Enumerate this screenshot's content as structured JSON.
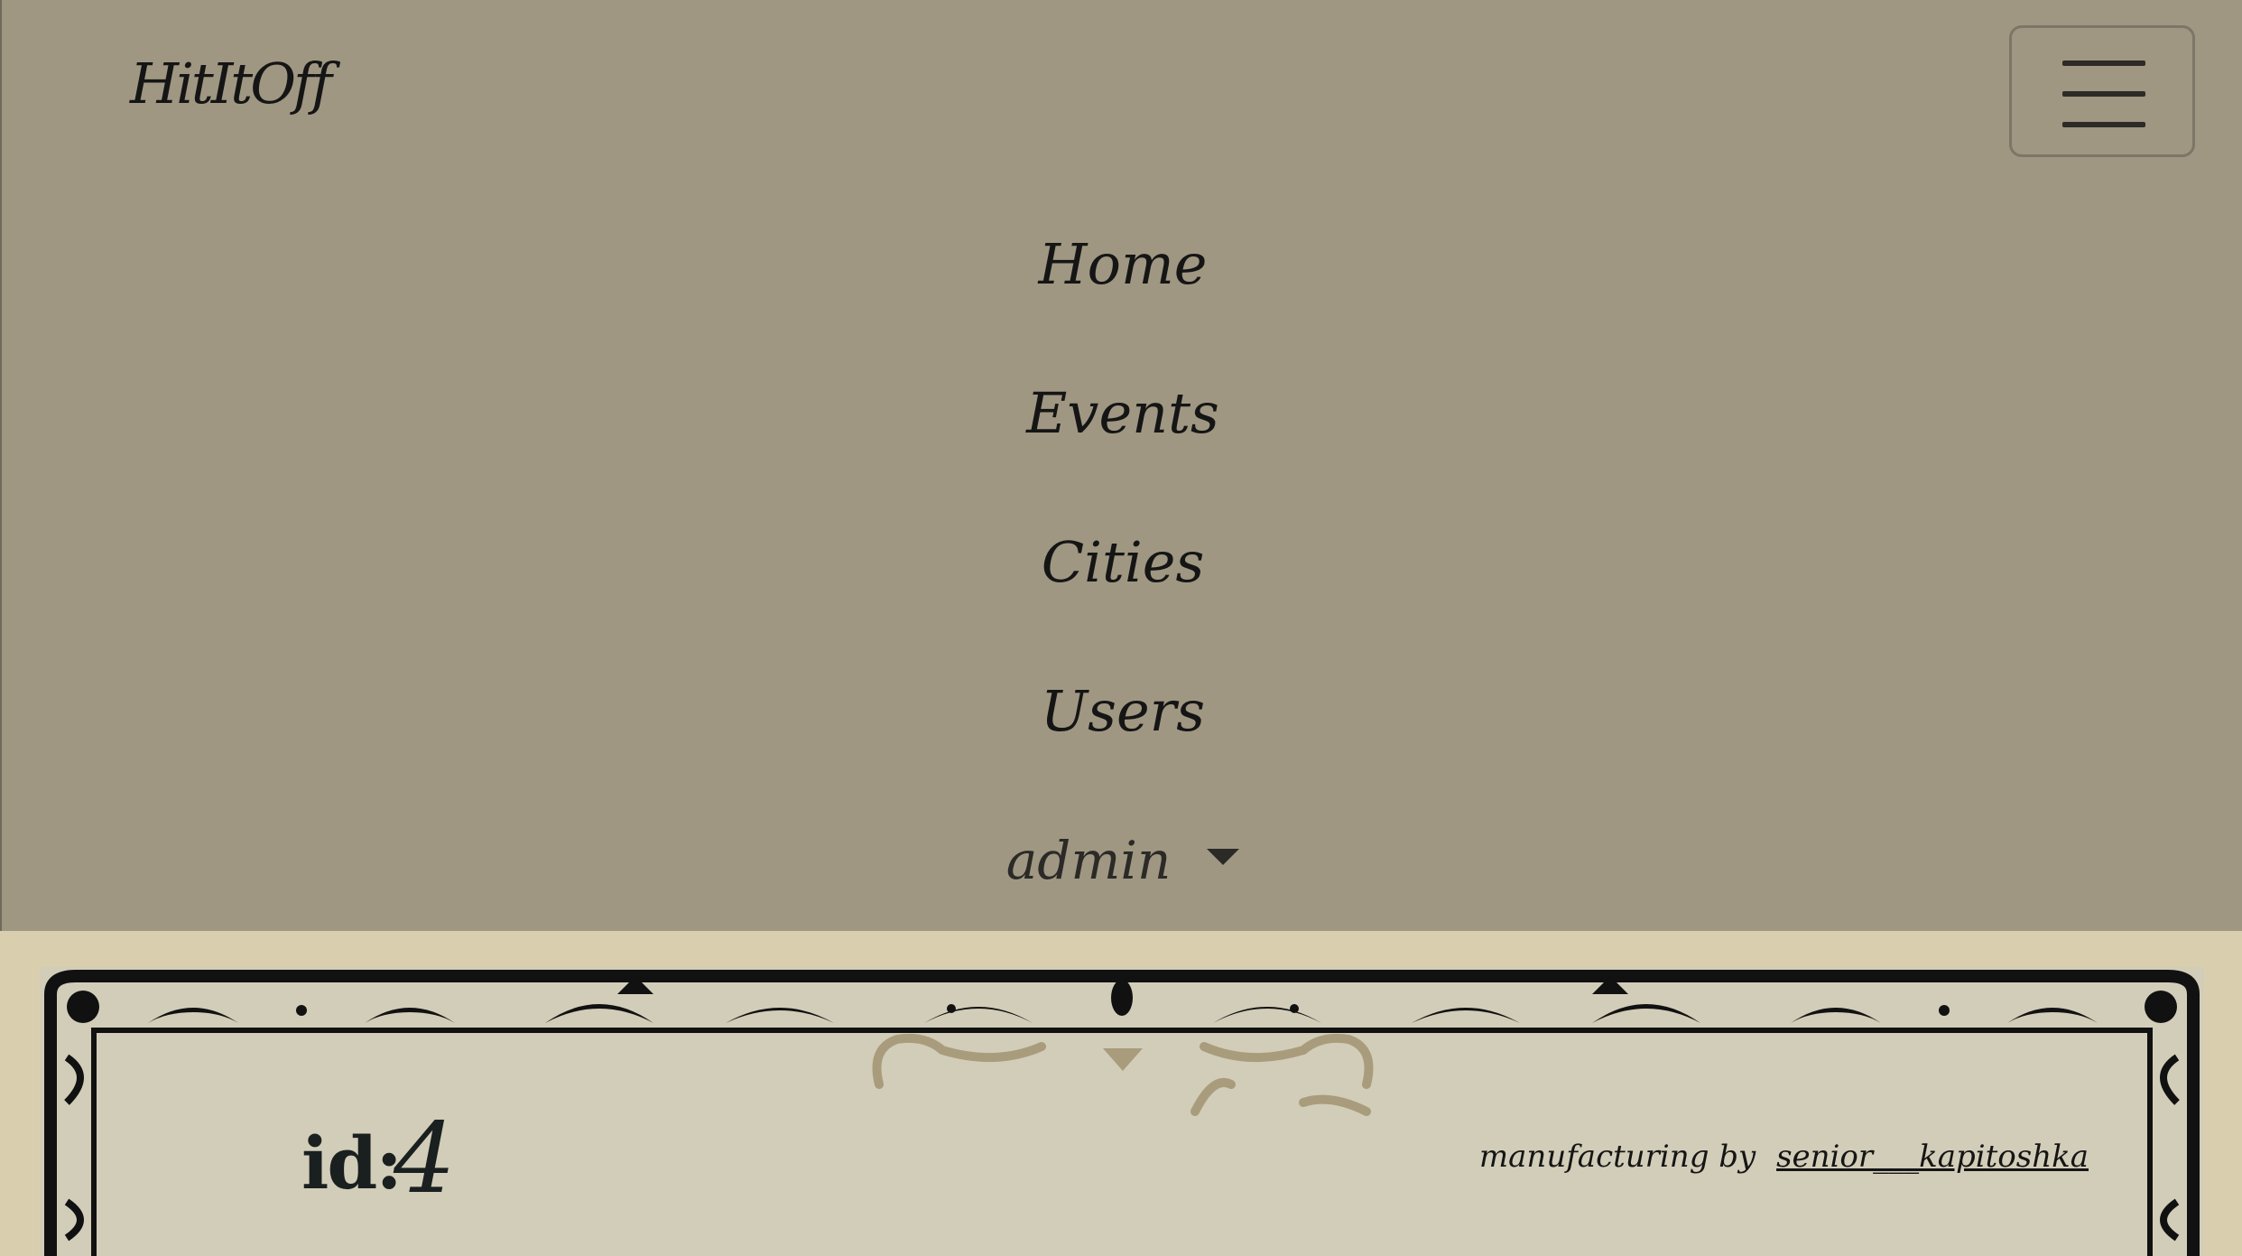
{
  "navbar": {
    "brand": "HitItOff",
    "menu": [
      {
        "label": "Home"
      },
      {
        "label": "Events"
      },
      {
        "label": "Cities"
      },
      {
        "label": "Users"
      }
    ],
    "user_dropdown": {
      "label": "admin"
    },
    "toggler_icon": "hamburger-icon"
  },
  "main": {
    "id_label": "id:",
    "id_value": "4",
    "credit_text": "manufacturing by",
    "credit_link": "senior___kapitoshka"
  },
  "colors": {
    "navbar_bg": "#9f9782",
    "page_bg": "#d9cfae",
    "card_bg": "#d2cdb8",
    "ornament_dark": "#111111",
    "ornament_accent": "#a99c7c"
  }
}
